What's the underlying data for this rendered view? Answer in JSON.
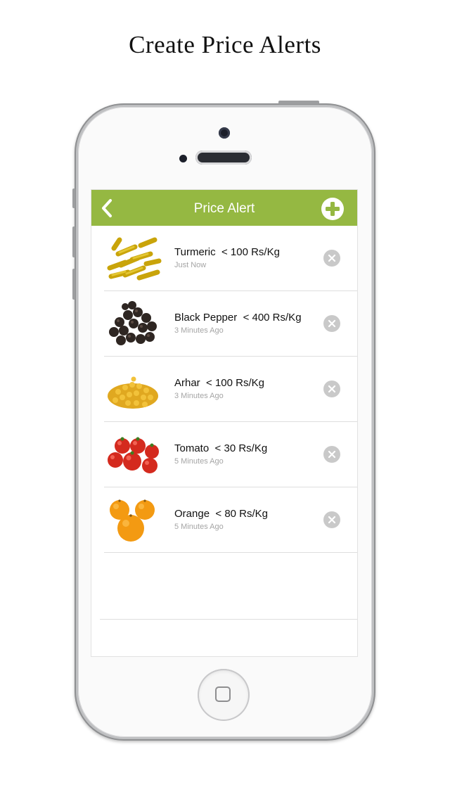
{
  "caption": "Create Price Alerts",
  "nav": {
    "title": "Price Alert",
    "back_icon": "chevron-left-icon",
    "add_icon": "plus-circle-icon",
    "color": "#95b842"
  },
  "alerts": [
    {
      "name": "Turmeric",
      "condition": "< 100 Rs/Kg",
      "time": "Just Now",
      "thumb": "turmeric"
    },
    {
      "name": "Black Pepper",
      "condition": "< 400 Rs/Kg",
      "time": "3 Minutes Ago",
      "thumb": "black-pepper"
    },
    {
      "name": "Arhar",
      "condition": "< 100 Rs/Kg",
      "time": "3 Minutes Ago",
      "thumb": "arhar"
    },
    {
      "name": "Tomato",
      "condition": "< 30 Rs/Kg",
      "time": "5 Minutes Ago",
      "thumb": "tomato"
    },
    {
      "name": "Orange",
      "condition": "< 80 Rs/Kg",
      "time": "5 Minutes Ago",
      "thumb": "orange"
    }
  ],
  "remove_icon": "close-circle-icon"
}
